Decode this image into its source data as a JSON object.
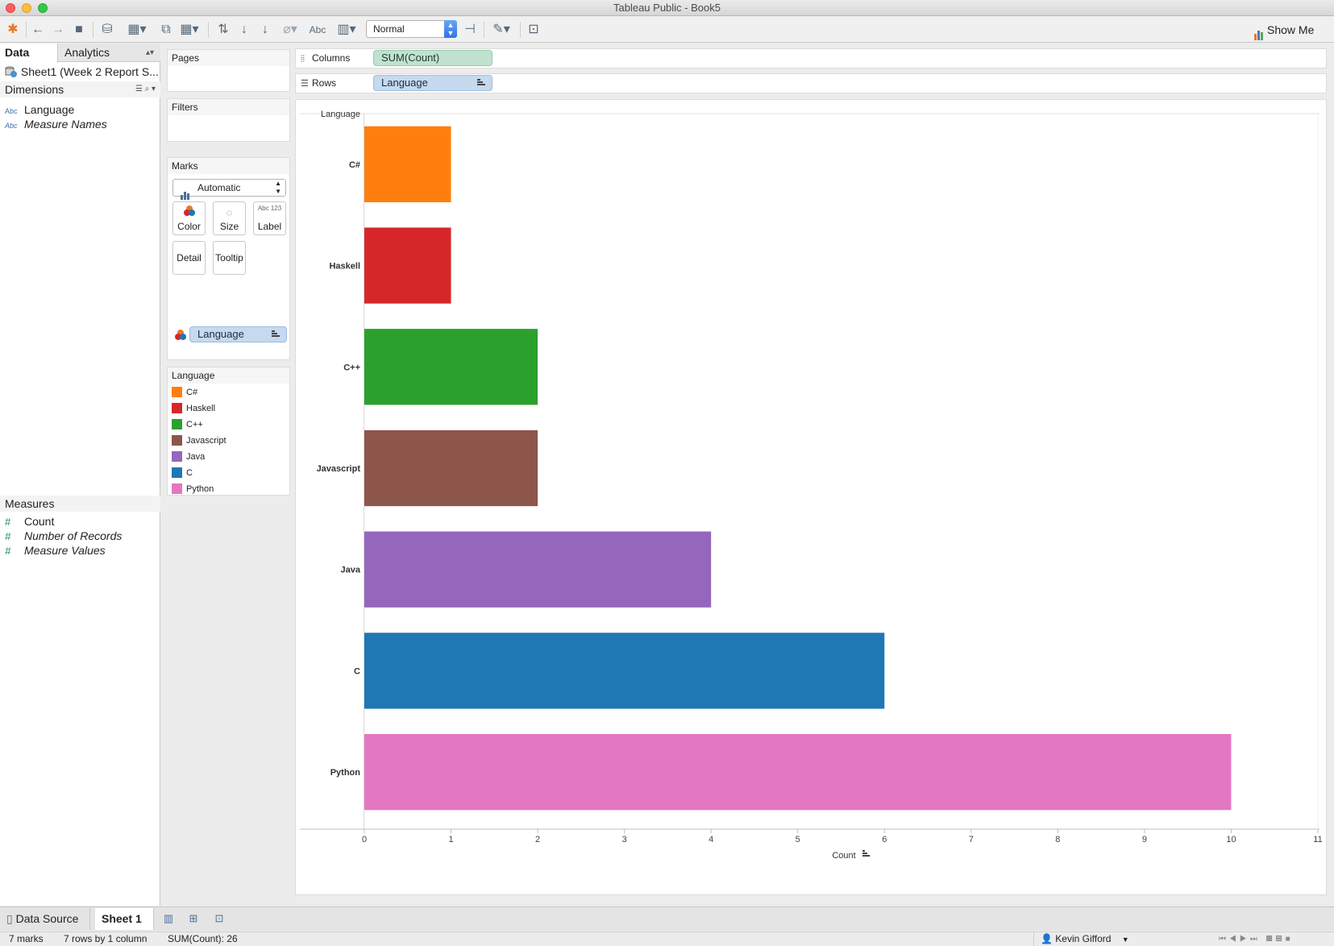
{
  "window": {
    "title": "Tableau Public - Book5"
  },
  "toolbar": {
    "fit_value": "Normal",
    "show_me_label": "Show Me",
    "text_tool_label": "Abc"
  },
  "data_pane": {
    "tabs": [
      "Data",
      "Analytics"
    ],
    "datasource": "Sheet1 (Week 2 Report S...",
    "dimensions_title": "Dimensions",
    "dimensions": [
      {
        "type": "Abc",
        "name": "Language",
        "italic": false
      },
      {
        "type": "Abc",
        "name": "Measure Names",
        "italic": true
      }
    ],
    "measures_title": "Measures",
    "measures": [
      {
        "name": "Count",
        "italic": false
      },
      {
        "name": "Number of Records",
        "italic": true
      },
      {
        "name": "Measure Values",
        "italic": true
      }
    ]
  },
  "cards": {
    "pages": "Pages",
    "filters": "Filters",
    "marks": "Marks",
    "mark_type": "Automatic",
    "buttons": {
      "color": "Color",
      "size": "Size",
      "label": "Label",
      "label_icon": "Abc 123",
      "detail": "Detail",
      "tooltip": "Tooltip"
    },
    "color_pill": "Language",
    "legend_title": "Language"
  },
  "shelves": {
    "columns_label": "Columns",
    "columns_pill": "SUM(Count)",
    "rows_label": "Rows",
    "rows_pill": "Language"
  },
  "chart_data": {
    "type": "bar",
    "orientation": "horizontal",
    "categories": [
      "C#",
      "Haskell",
      "C++",
      "Javascript",
      "Java",
      "C",
      "Python"
    ],
    "values": [
      1,
      1,
      2,
      2,
      4,
      6,
      10
    ],
    "colors": [
      "#ff7f0e",
      "#d62728",
      "#2ca02c",
      "#8c564b",
      "#9467bd",
      "#1f77b4",
      "#e377c2"
    ],
    "row_header": "Language",
    "xlabel": "Count",
    "xlim": [
      0,
      11
    ],
    "xticks": [
      0,
      1,
      2,
      3,
      4,
      5,
      6,
      7,
      8,
      9,
      10,
      11
    ]
  },
  "sheets": {
    "data_source_tab": "Data Source",
    "active_tab": "Sheet 1"
  },
  "status": {
    "marks": "7 marks",
    "rows_cols": "7 rows by 1 column",
    "sum": "SUM(Count): 26",
    "user": "Kevin Gifford"
  }
}
